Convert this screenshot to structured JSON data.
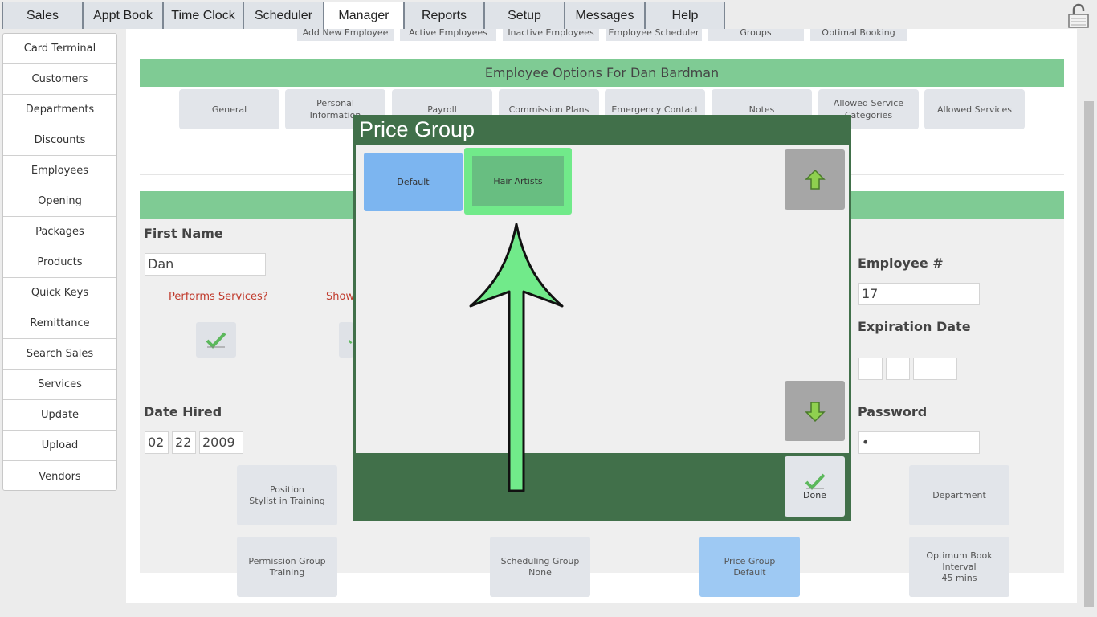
{
  "topnav": {
    "tabs": [
      "Sales",
      "Appt Book",
      "Time Clock",
      "Scheduler",
      "Manager",
      "Reports",
      "Setup",
      "Messages",
      "Help"
    ],
    "active": "Manager"
  },
  "sidebar": {
    "items": [
      "Card Terminal",
      "Customers",
      "Departments",
      "Discounts",
      "Employees",
      "Opening",
      "Packages",
      "Products",
      "Quick Keys",
      "Remittance",
      "Search Sales",
      "Services",
      "Update",
      "Upload",
      "Vendors"
    ]
  },
  "subtabs": [
    "Add New Employee",
    "Active Employees",
    "Inactive Employees",
    "Employee Scheduler",
    "Groups",
    "Optimal Booking"
  ],
  "options": {
    "title": "Employee Options For Dan Bardman",
    "buttons": [
      "General",
      "Personal Information",
      "Payroll",
      "Commission Plans",
      "Emergency Contact",
      "Notes",
      "Allowed Service Categories",
      "Allowed Services"
    ]
  },
  "form": {
    "first_name_label": "First Name",
    "first_name_value": "Dan",
    "performs_services": "Performs Services?",
    "show_label": "Show",
    "employee_num_label": "Employee #",
    "employee_num_value": "17",
    "expiration_label": "Expiration Date",
    "date_hired_label": "Date Hired",
    "date_month": "02",
    "date_day": "22",
    "date_year": "2009",
    "password_label": "Password",
    "password_value": "•",
    "position": "Position\nStylist in Training",
    "department": "Department",
    "permission_group": "Permission Group\nTraining",
    "scheduling_group": "Scheduling Group\nNone",
    "price_group": "Price Group\nDefault",
    "optimum_book": "Optimum Book\nInterval\n45 mins"
  },
  "modal": {
    "title": "Price Group",
    "options": [
      "Default",
      "Hair Artists"
    ],
    "selected": "Hair Artists",
    "done_label": "Done"
  },
  "colors": {
    "accent_green": "#7fcb94",
    "modal_green": "#41704a",
    "highlight_green": "#71ea8a",
    "blue": "#7cb5f0"
  }
}
